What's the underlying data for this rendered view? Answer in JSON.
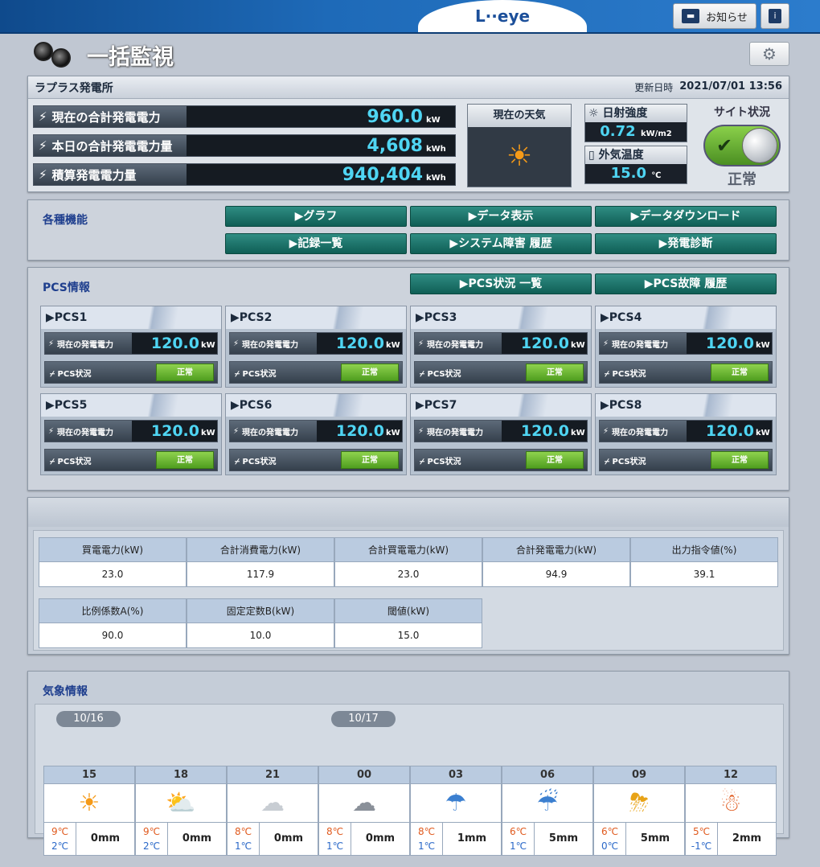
{
  "app": {
    "logo": "L··eye",
    "notice_label": "お知らせ",
    "info_label": "i",
    "page_title": "一括監視"
  },
  "site": {
    "name": "ラプラス発電所",
    "updated_label": "更新日時",
    "updated_value": "2021/07/01  13:56",
    "metrics": [
      {
        "label": "現在の合計発電電力",
        "value": "960.0",
        "unit": "kW"
      },
      {
        "label": "本日の合計発電電力量",
        "value": "4,608",
        "unit": "kWh"
      },
      {
        "label": "積算発電電力量",
        "value": "940,404",
        "unit": "kWh"
      }
    ],
    "weather_title": "現在の天気",
    "weather_icon": "sun-icon",
    "irradiance_label": "日射強度",
    "irradiance_value": "0.72",
    "irradiance_unit": "kW/m2",
    "temp_label": "外気温度",
    "temp_value": "15.0",
    "temp_unit": "℃",
    "status_title": "サイト状況",
    "status_value": "正常"
  },
  "functions": {
    "title": "各種機能",
    "buttons": [
      "▶グラフ",
      "▶データ表示",
      "▶データダウンロード",
      "▶記録一覧",
      "▶システム障害 履歴",
      "▶発電診断"
    ]
  },
  "pcs": {
    "title": "PCS情報",
    "buttons": [
      "▶PCS状況 一覧",
      "▶PCS故障 履歴"
    ],
    "power_label": "現在の発電電力",
    "status_label": "PCS状況",
    "unit": "kW",
    "units": [
      {
        "name": "▶PCS1",
        "power": "120.0",
        "status": "正常"
      },
      {
        "name": "▶PCS2",
        "power": "120.0",
        "status": "正常"
      },
      {
        "name": "▶PCS3",
        "power": "120.0",
        "status": "正常"
      },
      {
        "name": "▶PCS4",
        "power": "120.0",
        "status": "正常"
      },
      {
        "name": "▶PCS5",
        "power": "120.0",
        "status": "正常"
      },
      {
        "name": "▶PCS6",
        "power": "120.0",
        "status": "正常"
      },
      {
        "name": "▶PCS7",
        "power": "120.0",
        "status": "正常"
      },
      {
        "name": "▶PCS8",
        "power": "120.0",
        "status": "正常"
      }
    ]
  },
  "meter": {
    "row1": [
      {
        "label": "買電電力(kW)",
        "value": "23.0"
      },
      {
        "label": "合計消費電力(kW)",
        "value": "117.9"
      },
      {
        "label": "合計買電電力(kW)",
        "value": "23.0"
      },
      {
        "label": "合計発電電力(kW)",
        "value": "94.9"
      },
      {
        "label": "出力指令値(%)",
        "value": "39.1"
      }
    ],
    "row2": [
      {
        "label": "比例係数A(%)",
        "value": "90.0"
      },
      {
        "label": "固定定数B(kW)",
        "value": "10.0"
      },
      {
        "label": "閾値(kW)",
        "value": "15.0"
      }
    ]
  },
  "weather": {
    "title": "気象情報",
    "dates": [
      "10/16",
      "10/17"
    ],
    "hours": [
      {
        "time": "15",
        "icon": "sun-icon",
        "glyph": "☀",
        "hi": "9℃",
        "lo": "2℃",
        "rain": "0mm"
      },
      {
        "time": "18",
        "icon": "sun-cloud-icon",
        "glyph": "⛅",
        "hi": "9℃",
        "lo": "2℃",
        "rain": "0mm"
      },
      {
        "time": "21",
        "icon": "cloud-icon",
        "glyph": "☁",
        "hi": "8℃",
        "lo": "1℃",
        "rain": "0mm"
      },
      {
        "time": "00",
        "icon": "clouds-icon",
        "glyph": "☁",
        "hi": "8℃",
        "lo": "1℃",
        "rain": "0mm"
      },
      {
        "time": "03",
        "icon": "umbrella-closed-icon",
        "glyph": "☂",
        "hi": "8℃",
        "lo": "1℃",
        "rain": "1mm"
      },
      {
        "time": "06",
        "icon": "umbrella-rain-icon",
        "glyph": "☔",
        "hi": "6℃",
        "lo": "1℃",
        "rain": "5mm"
      },
      {
        "time": "09",
        "icon": "thunder-icon",
        "glyph": "⛈",
        "hi": "6℃",
        "lo": "0℃",
        "rain": "5mm"
      },
      {
        "time": "12",
        "icon": "snowman-icon",
        "glyph": "☃",
        "hi": "5℃",
        "lo": "-1℃",
        "rain": "2mm"
      }
    ]
  }
}
